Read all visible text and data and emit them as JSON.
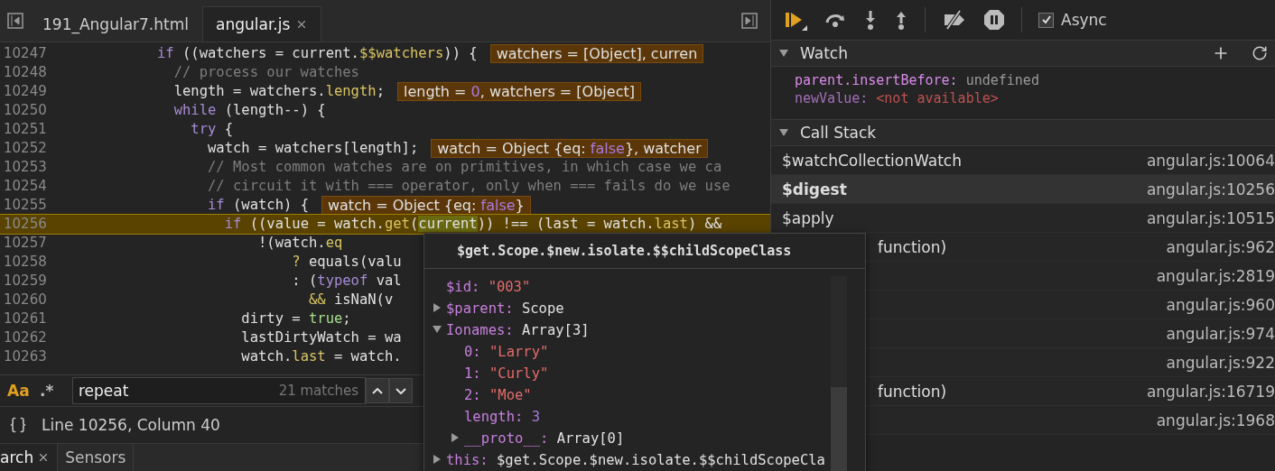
{
  "editor": {
    "tabs": [
      {
        "label": "191_Angular7.html",
        "selected": false,
        "closable": false
      },
      {
        "label": "angular.js",
        "selected": true,
        "closable": true
      }
    ],
    "lines": [
      {
        "number": "10247",
        "current": false,
        "tokens": [
          {
            "kind": "keyword",
            "text": "            if"
          },
          {
            "kind": "plain",
            "text": " ((watchers = current."
          },
          {
            "kind": "member",
            "text": "$$watchers"
          },
          {
            "kind": "plain",
            "text": ")) {"
          }
        ],
        "inline": [
          {
            "kind": "plain",
            "text": "watchers = [Object], curren"
          }
        ]
      },
      {
        "number": "10248",
        "current": false,
        "tokens": [
          {
            "kind": "comment",
            "text": "              // process our watches"
          }
        ]
      },
      {
        "number": "10249",
        "current": false,
        "tokens": [
          {
            "kind": "plain",
            "text": "              length = watchers."
          },
          {
            "kind": "member",
            "text": "length"
          },
          {
            "kind": "plain",
            "text": ";"
          }
        ],
        "inline": [
          {
            "kind": "plain",
            "text": "length = "
          },
          {
            "kind": "literal",
            "text": "0"
          },
          {
            "kind": "plain",
            "text": ", watchers = [Object]"
          }
        ]
      },
      {
        "number": "10250",
        "current": false,
        "tokens": [
          {
            "kind": "keyword",
            "text": "              while"
          },
          {
            "kind": "plain",
            "text": " (length--) {"
          }
        ]
      },
      {
        "number": "10251",
        "current": false,
        "tokens": [
          {
            "kind": "keyword",
            "text": "                try"
          },
          {
            "kind": "plain",
            "text": " {"
          }
        ]
      },
      {
        "number": "10252",
        "current": false,
        "tokens": [
          {
            "kind": "plain",
            "text": "                  watch = watchers[length];"
          }
        ],
        "inline": [
          {
            "kind": "plain",
            "text": "watch = Object {eq: "
          },
          {
            "kind": "literal",
            "text": "false"
          },
          {
            "kind": "plain",
            "text": "}, watcher"
          }
        ]
      },
      {
        "number": "10253",
        "current": false,
        "tokens": [
          {
            "kind": "comment",
            "text": "                  // Most common watches are on primitives, in which case we ca"
          }
        ]
      },
      {
        "number": "10254",
        "current": false,
        "tokens": [
          {
            "kind": "comment",
            "text": "                  // circuit it with === operator, only when === fails do we use"
          }
        ]
      },
      {
        "number": "10255",
        "current": false,
        "tokens": [
          {
            "kind": "keyword",
            "text": "                  if"
          },
          {
            "kind": "plain",
            "text": " (watch) {"
          }
        ],
        "inline": [
          {
            "kind": "plain",
            "text": "watch = Object {eq: "
          },
          {
            "kind": "literal",
            "text": "false"
          },
          {
            "kind": "plain",
            "text": "}"
          }
        ]
      },
      {
        "number": "10256",
        "current": true,
        "tokens": [
          {
            "kind": "keyword",
            "text": "                    if"
          },
          {
            "kind": "plain",
            "text": " ((value = watch."
          },
          {
            "kind": "member",
            "text": "get"
          },
          {
            "kind": "plain",
            "text": "("
          },
          {
            "kind": "highlight",
            "text": "current"
          },
          {
            "kind": "plain",
            "text": ")) !== (last = watch."
          },
          {
            "kind": "member",
            "text": "last"
          },
          {
            "kind": "plain",
            "text": ") &&"
          }
        ]
      },
      {
        "number": "10257",
        "current": false,
        "tokens": [
          {
            "kind": "plain",
            "text": "                        !(watch."
          },
          {
            "kind": "member",
            "text": "eq"
          }
        ]
      },
      {
        "number": "10258",
        "current": false,
        "tokens": [
          {
            "kind": "member",
            "text": "                            ?"
          },
          {
            "kind": "plain",
            "text": " equals(valu"
          }
        ]
      },
      {
        "number": "10259",
        "current": false,
        "tokens": [
          {
            "kind": "plain",
            "text": "                            : ("
          },
          {
            "kind": "keyword",
            "text": "typeof"
          },
          {
            "kind": "plain",
            "text": " val"
          }
        ]
      },
      {
        "number": "10260",
        "current": false,
        "tokens": [
          {
            "kind": "member",
            "text": "                              &&"
          },
          {
            "kind": "plain",
            "text": " isNaN(v"
          }
        ]
      },
      {
        "number": "10261",
        "current": false,
        "tokens": [
          {
            "kind": "plain",
            "text": "                      dirty = "
          },
          {
            "kind": "literal_true",
            "text": "true"
          },
          {
            "kind": "plain",
            "text": ";"
          }
        ]
      },
      {
        "number": "10262",
        "current": false,
        "tokens": [
          {
            "kind": "plain",
            "text": "                      lastDirtyWatch = wa"
          }
        ]
      },
      {
        "number": "10263",
        "current": false,
        "tokens": [
          {
            "kind": "plain",
            "text": "                      watch."
          },
          {
            "kind": "member",
            "text": "last"
          },
          {
            "kind": "plain",
            "text": " = watch."
          }
        ]
      }
    ],
    "search": {
      "case_sensitive": true,
      "regex_label": ".*",
      "case_label": "Aa",
      "value": "repeat",
      "matches": "21 matches"
    },
    "status": "Line 10256, Column 40"
  },
  "drawer_tabs": [
    {
      "label": "arch",
      "selected": true,
      "closable": true
    },
    {
      "label": "Sensors",
      "selected": false,
      "closable": false
    }
  ],
  "toolbar": {
    "async_label": "Async",
    "async_checked": true
  },
  "watch": {
    "title": "Watch",
    "expanded": true,
    "items": [
      {
        "name": "parent.insertBefore:",
        "value": "undefined",
        "kind": "plain"
      },
      {
        "name": "newValue:",
        "value": "<not available>",
        "kind": "unavailable"
      }
    ]
  },
  "call_stack": {
    "title": "Call Stack",
    "expanded": true,
    "frames": [
      {
        "name": "$watchCollectionWatch",
        "location": "angular.js:10064",
        "selected": false
      },
      {
        "name": "$digest",
        "location": "angular.js:10256",
        "selected": true
      },
      {
        "name": "$apply",
        "location": "angular.js:10515",
        "selected": false
      },
      {
        "name": "function)",
        "location": "angular.js:962",
        "selected": false
      },
      {
        "location": "angular.js:2819",
        "selected": false
      },
      {
        "location": "angular.js:960",
        "selected": false
      },
      {
        "location": "angular.js:974",
        "selected": false
      },
      {
        "location": "angular.js:922",
        "selected": false
      },
      {
        "name": "function)",
        "location": "angular.js:16719",
        "selected": false
      },
      {
        "location": "angular.js:1968",
        "selected": false
      }
    ]
  },
  "popover": {
    "title": "$get.Scope.$new.isolate.$$childScopeClass",
    "properties": [
      {
        "key": "$id:",
        "value": "\"003\"",
        "kind": "string",
        "expandable": false
      },
      {
        "key": "$parent:",
        "value": "Scope",
        "kind": "object",
        "expandable": true,
        "expanded": false
      },
      {
        "key": "Ionames:",
        "value": "Array[3]",
        "kind": "object",
        "expandable": true,
        "expanded": true,
        "children": [
          {
            "key": "0:",
            "value": "\"Larry\"",
            "kind": "string",
            "expandable": false
          },
          {
            "key": "1:",
            "value": "\"Curly\"",
            "kind": "string",
            "expandable": false
          },
          {
            "key": "2:",
            "value": "\"Moe\"",
            "kind": "string",
            "expandable": false
          },
          {
            "key": "length:",
            "value": "3",
            "kind": "number",
            "expandable": false
          },
          {
            "key": "__proto__:",
            "value": "Array[0]",
            "kind": "object",
            "expandable": true,
            "expanded": false
          }
        ]
      },
      {
        "key": "this:",
        "value": "$get.Scope.$new.isolate.$$childScopeCla",
        "kind": "object",
        "expandable": true,
        "expanded": false
      }
    ]
  }
}
